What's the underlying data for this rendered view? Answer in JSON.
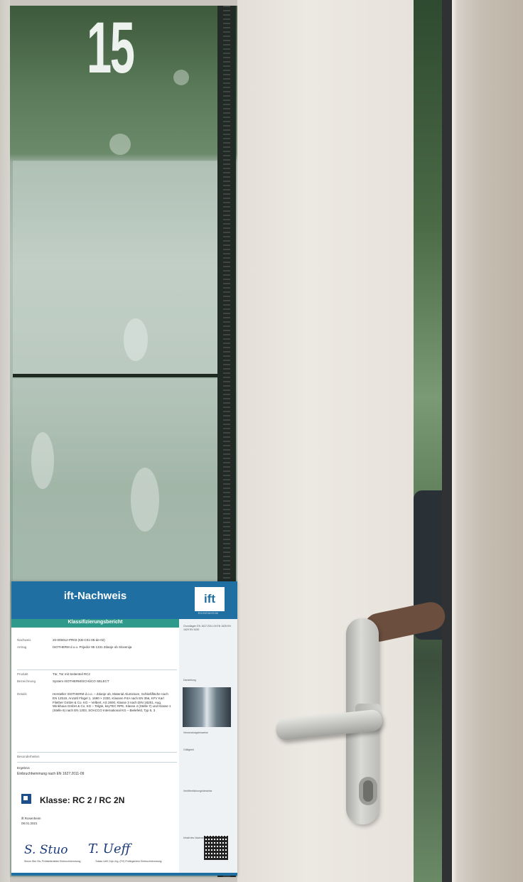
{
  "scene": {
    "house_number": "15"
  },
  "certificate": {
    "title": "ift-Nachweis",
    "subtitle": "Klassifizierungsbericht",
    "logo_text": "ift",
    "logo_subtext": "ROSENHEIM",
    "rows": [
      {
        "key": "Nachweis",
        "value": "20-005012-PR03 (KB-C01-05-de-02)"
      },
      {
        "key": "Antrag",
        "value": "ISOTHERM d.o.o. Prijedor 95 1331 Zdanje ob Slovenija"
      },
      {
        "key": "Produkt",
        "value": "Tür, Tür mit Seitenteil RC2"
      },
      {
        "key": "Bezeichnung",
        "value": "System ISOTHERM/SCHÜCO SELECT"
      },
      {
        "key": "Details",
        "value": "Hersteller ISOTHERM d.o.o. – Zdanje ob, Material Aluminium, Schließfläche nach EN 12519, Anzahl Flügel 1, 1690 × 2330, Klassen P4A nach EN 356, KFV Karl Fliether GmbH & Co. KG – Velbert, AS 2600, Klasse 3 nach DIN 18251, Aug. Winkhaus GmbH & Co. KG – Telgte, keyTEC RPE, Klasse 4 (Stelle 7) und Klasse 1 (Stelle 6) nach EN 1303, SOACCO International KG – Bielefeld, Typ 5, 3"
      },
      {
        "key": "Besonderheiten",
        "value": ""
      }
    ],
    "test_label": "Ergebnis",
    "test_value": "Einbruchhemmung nach EN 1627:2011-09",
    "classification": "Klasse: RC 2 / RC 2N",
    "place": "ift Rosenheim",
    "date": "08.01.2021",
    "signature_left": "S. Stuo",
    "signature_right": "T. Ueff",
    "signer_left": "Simon Ster Stv. Prüfstellenleiter Einbruchhemmung",
    "signer_right": "Tobias Ueff, Dipl.-Ing. (FH) Prüfingenieur Einbruchhemmung",
    "side_blocks": [
      "Grundlagen EN 1627:2011-09 EN 1628 EN 1629 EN 1630",
      "Darstellung",
      "Verwendungshinweise",
      "Gültigkeit",
      "Veröffentlichungshinweise",
      "Inhalt des Nachweises"
    ]
  }
}
